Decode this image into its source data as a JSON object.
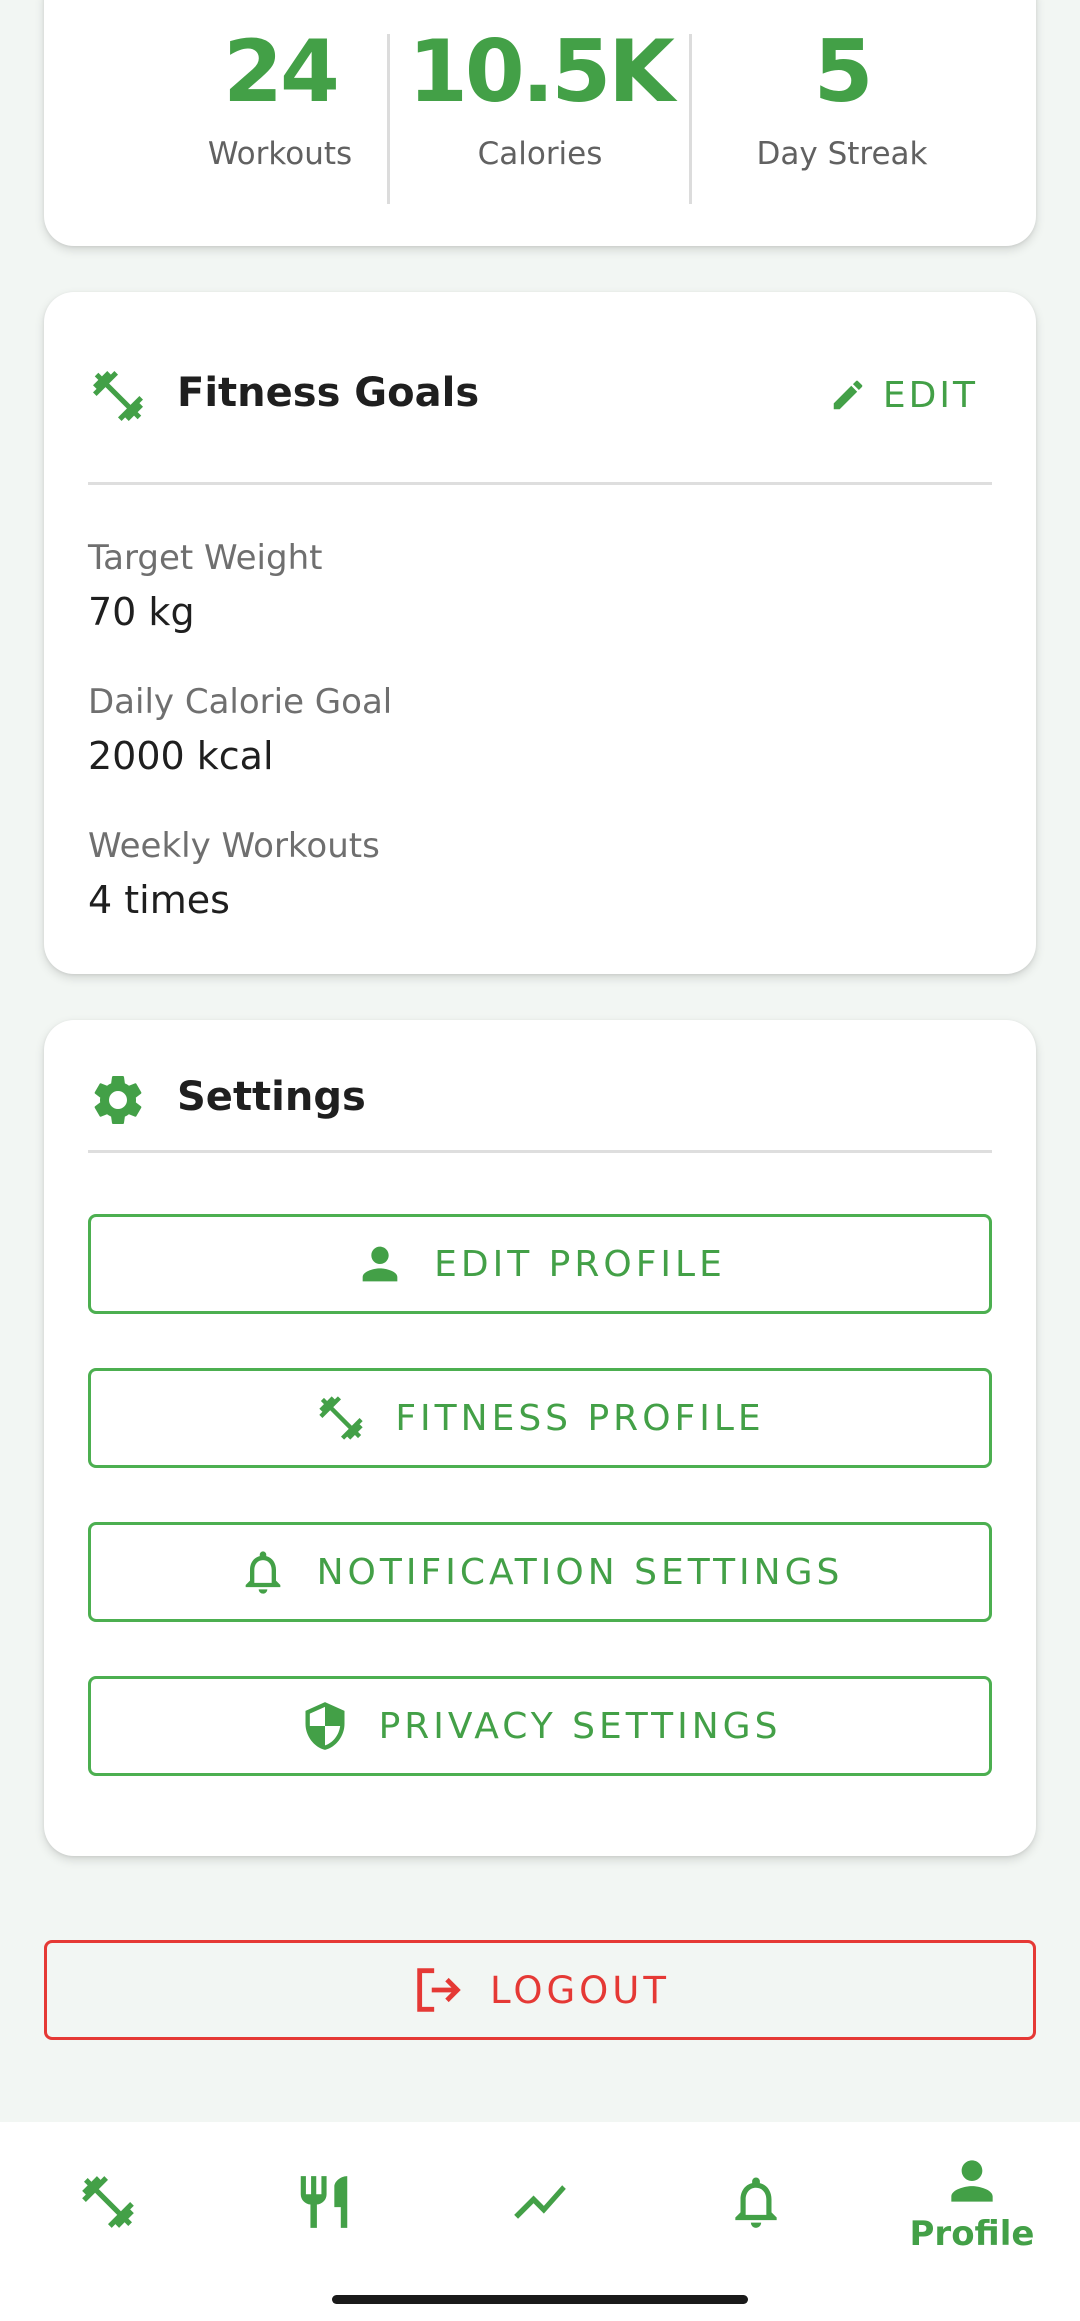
{
  "stats": [
    {
      "value": "24",
      "label": "Workouts"
    },
    {
      "value": "10.5K",
      "label": "Calories"
    },
    {
      "value": "5",
      "label": "Day Streak"
    }
  ],
  "fitness_goals": {
    "title": "Fitness Goals",
    "edit_label": "EDIT",
    "items": [
      {
        "label": "Target Weight",
        "value": "70 kg"
      },
      {
        "label": "Daily Calorie Goal",
        "value": "2000 kcal"
      },
      {
        "label": "Weekly Workouts",
        "value": "4 times"
      }
    ]
  },
  "settings": {
    "title": "Settings",
    "buttons": [
      {
        "label": "EDIT PROFILE",
        "icon": "person-icon"
      },
      {
        "label": "FITNESS PROFILE",
        "icon": "dumbbell-icon"
      },
      {
        "label": "NOTIFICATION SETTINGS",
        "icon": "bell-icon"
      },
      {
        "label": "PRIVACY SETTINGS",
        "icon": "shield-icon"
      }
    ]
  },
  "logout": {
    "label": "LOGOUT",
    "icon": "logout-icon"
  },
  "bottom_nav": {
    "items": [
      {
        "icon": "dumbbell-icon",
        "label": ""
      },
      {
        "icon": "restaurant-icon",
        "label": ""
      },
      {
        "icon": "trending-icon",
        "label": ""
      },
      {
        "icon": "bell-icon",
        "label": ""
      },
      {
        "icon": "person-icon",
        "label": "Profile",
        "active": true
      }
    ]
  },
  "colors": {
    "accent": "#43a047",
    "danger": "#e53935",
    "background": "#f2f6f3",
    "card": "#ffffff"
  }
}
